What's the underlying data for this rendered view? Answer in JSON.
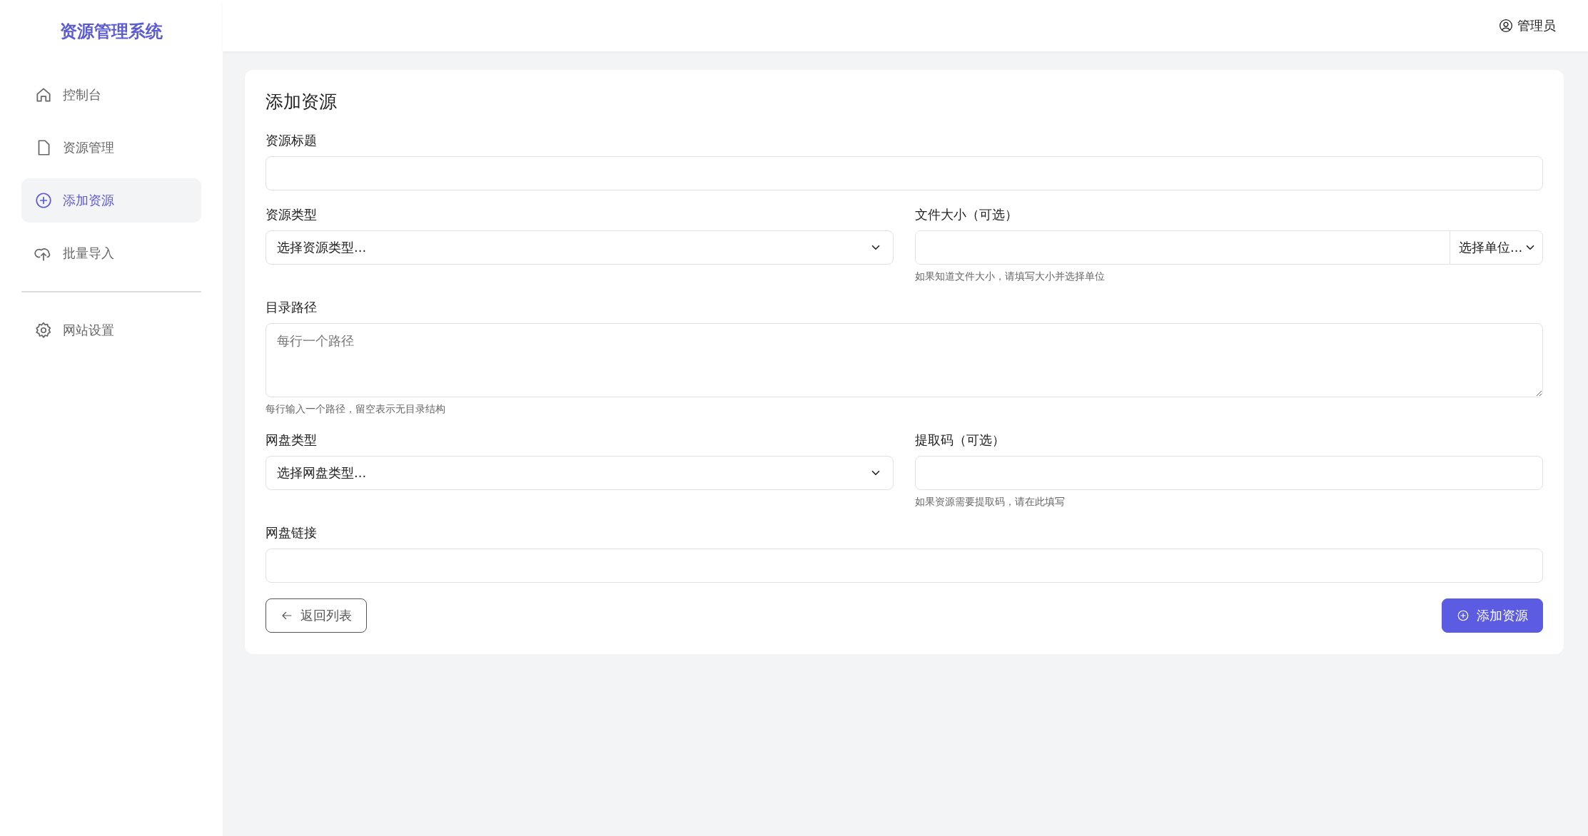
{
  "sidebar": {
    "brand": "资源管理系统",
    "items": [
      {
        "label": "控制台",
        "selected": false
      },
      {
        "label": "资源管理",
        "selected": false
      },
      {
        "label": "添加资源",
        "selected": true
      },
      {
        "label": "批量导入",
        "selected": false
      }
    ],
    "settings_items": [
      {
        "label": "网站设置",
        "selected": false
      }
    ]
  },
  "header": {
    "user": "管理员"
  },
  "form": {
    "title": "添加资源",
    "rows": [
      [
        {
          "kind": "text",
          "label": "资源标题"
        }
      ],
      [
        {
          "kind": "select",
          "label": "资源类型",
          "value": "选择资源类型..."
        },
        {
          "kind": "size",
          "label": "文件大小（可选）",
          "unit": "选择单位...",
          "hint": "如果知道文件大小，请填写大小并选择单位"
        }
      ],
      [
        {
          "kind": "textarea",
          "label": "目录路径",
          "placeholder": "每行一个路径",
          "hint": "每行输入一个路径，留空表示无目录结构"
        }
      ],
      [
        {
          "kind": "select",
          "label": "网盘类型",
          "value": "选择网盘类型..."
        },
        {
          "kind": "text",
          "label": "提取码（可选）",
          "hint": "如果资源需要提取码，请在此填写"
        }
      ],
      [
        {
          "kind": "text",
          "label": "网盘链接"
        }
      ]
    ],
    "buttons": [
      {
        "kind": "back",
        "label": "返回列表"
      },
      {
        "kind": "submit",
        "label": "添加资源"
      }
    ]
  }
}
